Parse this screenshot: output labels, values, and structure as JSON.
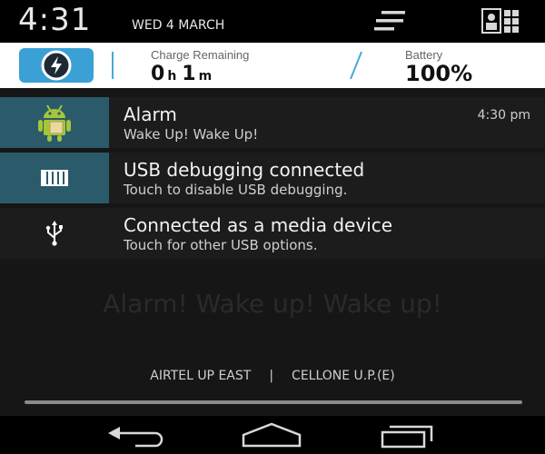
{
  "status_bar": {
    "time": "4:31",
    "date": "WED 4 MARCH"
  },
  "battery_widget": {
    "charge_label": "Charge Remaining",
    "charge_hours": "0",
    "charge_hours_unit": "h",
    "charge_minutes": "1",
    "charge_minutes_unit": "m",
    "battery_label": "Battery",
    "battery_value": "100%",
    "accent_color": "#3aa0d6"
  },
  "notifications": [
    {
      "icon": "android-alarm-icon",
      "title": "Alarm",
      "text": "Wake Up! Wake Up!",
      "time": "4:30 pm"
    },
    {
      "icon": "usb-debugging-icon",
      "title": "USB debugging connected",
      "text": "Touch to disable USB debugging."
    },
    {
      "icon": "usb-icon",
      "title": "Connected as a media device",
      "text": "Touch for other USB options."
    }
  ],
  "background": {
    "alarm_text": "Alarm! Wake up! Wake up!"
  },
  "carriers": {
    "left": "AIRTEL UP EAST",
    "separator": "|",
    "right": "CELLONE U.P.(E)"
  },
  "nav_icons": [
    "back-icon",
    "home-icon",
    "recent-apps-icon"
  ]
}
